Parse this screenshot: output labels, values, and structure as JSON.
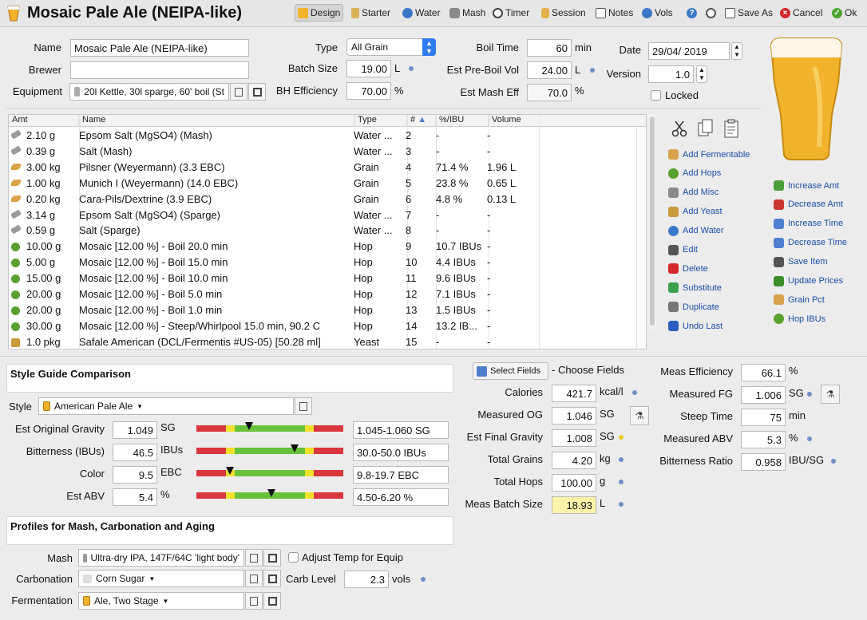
{
  "header": {
    "title": "Mosaic Pale Ale (NEIPA-like)",
    "tabs": [
      {
        "label": "Design",
        "icon": "beer-glass-icon"
      },
      {
        "label": "Starter",
        "icon": "test-tube-icon"
      },
      {
        "label": "Water",
        "icon": "water-drop-icon"
      },
      {
        "label": "Mash",
        "icon": "mash-tun-icon"
      },
      {
        "label": "Timer",
        "icon": "clock-icon"
      },
      {
        "label": "Session",
        "icon": "jar-icon"
      },
      {
        "label": "Notes",
        "icon": "notes-icon"
      },
      {
        "label": "Vols",
        "icon": "drop-icon"
      }
    ],
    "save_as": "Save As",
    "cancel": "Cancel",
    "ok": "Ok"
  },
  "form": {
    "name_label": "Name",
    "name_value": "Mosaic Pale Ale (NEIPA-like)",
    "brewer_label": "Brewer",
    "brewer_value": "",
    "equipment_label": "Equipment",
    "equipment_value": "20l Kettle, 30l sparge, 60' boil (St",
    "type_label": "Type",
    "type_value": "All Grain",
    "batch_label": "Batch Size",
    "batch_value": "19.00",
    "batch_unit": "L",
    "bh_label": "BH Efficiency",
    "bh_value": "70.00",
    "bh_unit": "%",
    "boil_label": "Boil Time",
    "boil_value": "60",
    "boil_unit": "min",
    "preboil_label": "Est Pre-Boil Vol",
    "preboil_value": "24.00",
    "preboil_unit": "L",
    "mash_eff_label": "Est Mash Eff",
    "mash_eff_value": "70.0",
    "mash_eff_unit": "%",
    "date_label": "Date",
    "date_value": "29/04/ 2019",
    "version_label": "Version",
    "version_value": "1.0",
    "locked_label": "Locked"
  },
  "table": {
    "headers": [
      "Amt",
      "Name",
      "Type",
      "#",
      "%/IBU",
      "Volume"
    ],
    "rows": [
      {
        "amt": "2.10 g",
        "name": "Epsom Salt (MgSO4) (Mash)",
        "type": "Water ...",
        "num": "2",
        "pct": "-",
        "vol": "-",
        "icon": "salt-icon"
      },
      {
        "amt": "0.39 g",
        "name": "Salt (Mash)",
        "type": "Water ...",
        "num": "3",
        "pct": "-",
        "vol": "-",
        "icon": "salt-icon"
      },
      {
        "amt": "3.00 kg",
        "name": "Pilsner (Weyermann) (3.3 EBC)",
        "type": "Grain",
        "num": "4",
        "pct": "71.4 %",
        "vol": "1.96 L",
        "icon": "grain-icon"
      },
      {
        "amt": "1.00 kg",
        "name": "Munich I (Weyermann) (14.0 EBC)",
        "type": "Grain",
        "num": "5",
        "pct": "23.8 %",
        "vol": "0.65 L",
        "icon": "grain-icon"
      },
      {
        "amt": "0.20 kg",
        "name": "Cara-Pils/Dextrine (3.9 EBC)",
        "type": "Grain",
        "num": "6",
        "pct": "4.8 %",
        "vol": "0.13 L",
        "icon": "grain-icon"
      },
      {
        "amt": "3.14 g",
        "name": "Epsom Salt (MgSO4) (Sparge)",
        "type": "Water ...",
        "num": "7",
        "pct": "-",
        "vol": "-",
        "icon": "salt-icon"
      },
      {
        "amt": "0.59 g",
        "name": "Salt (Sparge)",
        "type": "Water ...",
        "num": "8",
        "pct": "-",
        "vol": "-",
        "icon": "salt-icon"
      },
      {
        "amt": "10.00 g",
        "name": "Mosaic [12.00 %] - Boil 20.0 min",
        "type": "Hop",
        "num": "9",
        "pct": "10.7 IBUs",
        "vol": "-",
        "icon": "hop-icon"
      },
      {
        "amt": "5.00 g",
        "name": "Mosaic [12.00 %] - Boil 15.0 min",
        "type": "Hop",
        "num": "10",
        "pct": "4.4 IBUs",
        "vol": "-",
        "icon": "hop-icon"
      },
      {
        "amt": "15.00 g",
        "name": "Mosaic [12.00 %] - Boil 10.0 min",
        "type": "Hop",
        "num": "11",
        "pct": "9.6 IBUs",
        "vol": "-",
        "icon": "hop-icon"
      },
      {
        "amt": "20.00 g",
        "name": "Mosaic [12.00 %] - Boil 5.0 min",
        "type": "Hop",
        "num": "12",
        "pct": "7.1 IBUs",
        "vol": "-",
        "icon": "hop-icon"
      },
      {
        "amt": "20.00 g",
        "name": "Mosaic [12.00 %] - Boil 1.0 min",
        "type": "Hop",
        "num": "13",
        "pct": "1.5 IBUs",
        "vol": "-",
        "icon": "hop-icon"
      },
      {
        "amt": "30.00 g",
        "name": "Mosaic [12.00 %] - Steep/Whirlpool  15.0 min, 90.2 C",
        "type": "Hop",
        "num": "14",
        "pct": "13.2 IB...",
        "vol": "-",
        "icon": "hop-icon"
      },
      {
        "amt": "1.0 pkg",
        "name": "Safale American  (DCL/Fermentis #US-05) [50.28 ml]",
        "type": "Yeast",
        "num": "15",
        "pct": "-",
        "vol": "-",
        "icon": "yeast-icon"
      }
    ]
  },
  "actions": [
    {
      "label": "Add Fermentable",
      "icon": "grain-icon",
      "color": "#d8a24a"
    },
    {
      "label": "Add Hops",
      "icon": "hop-icon",
      "color": "#5aa02c"
    },
    {
      "label": "Add Misc",
      "icon": "salt-icon",
      "color": "#8a8a8a"
    },
    {
      "label": "Add Yeast",
      "icon": "yeast-icon",
      "color": "#c99a3a"
    },
    {
      "label": "Add Water",
      "icon": "water-drop-icon",
      "color": "#3b78c9"
    },
    {
      "label": "Edit",
      "icon": "edit-icon",
      "color": "#555555"
    },
    {
      "label": "Delete",
      "icon": "delete-icon",
      "color": "#d4262c"
    },
    {
      "label": "Substitute",
      "icon": "substitute-icon",
      "color": "#3aa04a"
    },
    {
      "label": "Duplicate",
      "icon": "duplicate-icon",
      "color": "#777777"
    },
    {
      "label": "Undo Last",
      "icon": "undo-icon",
      "color": "#2b5fbf"
    }
  ],
  "actions2": [
    {
      "label": "Increase Amt",
      "icon": "arrow-up-icon",
      "color": "#4a9e3a"
    },
    {
      "label": "Decrease Amt",
      "icon": "arrow-down-icon",
      "color": "#c9362e"
    },
    {
      "label": "Increase Time",
      "icon": "triangle-up-icon",
      "color": "#4f7fcf"
    },
    {
      "label": "Decrease Time",
      "icon": "triangle-down-icon",
      "color": "#4f7fcf"
    },
    {
      "label": "Save Item",
      "icon": "save-icon",
      "color": "#555555"
    },
    {
      "label": "Update Prices",
      "icon": "dollar-icon",
      "color": "#3a8e2a"
    },
    {
      "label": "Grain Pct",
      "icon": "grain-icon",
      "color": "#d8a24a"
    },
    {
      "label": "Hop IBUs",
      "icon": "hop-icon",
      "color": "#5aa02c"
    }
  ],
  "style": {
    "section_title": "Style Guide Comparison",
    "style_label": "Style",
    "style_value": "American Pale Ale",
    "rows": [
      {
        "label": "Est Original Gravity",
        "value": "1.049",
        "unit": "SG",
        "range": "1.045-1.060 SG",
        "marker": 0.36
      },
      {
        "label": "Bitterness (IBUs)",
        "value": "46.5",
        "unit": "IBUs",
        "range": "30.0-50.0 IBUs",
        "marker": 0.67
      },
      {
        "label": "Color",
        "value": "9.5",
        "unit": "EBC",
        "range": "9.8-19.7 EBC",
        "marker": 0.23
      },
      {
        "label": "Est ABV",
        "value": "5.4",
        "unit": "%",
        "range": "4.50-6.20 %",
        "marker": 0.51
      }
    ]
  },
  "profiles": {
    "section_title": "Profiles for Mash, Carbonation and Aging",
    "mash_label": "Mash",
    "mash_value": "Ultra-dry IPA, 147F/64C 'light body'",
    "adjust_label": "Adjust Temp for Equip",
    "carb_label": "Carbonation",
    "carb_value": "Corn Sugar",
    "carb_level_label": "Carb Level",
    "carb_level_value": "2.3",
    "carb_level_unit": "vols",
    "ferm_label": "Fermentation",
    "ferm_value": "Ale, Two Stage"
  },
  "stats": {
    "select_fields": "Select Fields",
    "choose_fields": "- Choose Fields",
    "left": [
      {
        "label": "Calories",
        "value": "421.7",
        "unit": "kcal/l"
      },
      {
        "label": "Measured OG",
        "value": "1.046",
        "unit": "SG"
      },
      {
        "label": "Est Final Gravity",
        "value": "1.008",
        "unit": "SG"
      },
      {
        "label": "Total Grains",
        "value": "4.20",
        "unit": "kg"
      },
      {
        "label": "Total Hops",
        "value": "100.00",
        "unit": "g"
      },
      {
        "label": "Meas Batch Size",
        "value": "18.93",
        "unit": "L"
      }
    ],
    "right": [
      {
        "label": "Meas Efficiency",
        "value": "66.1",
        "unit": "%"
      },
      {
        "label": "Measured FG",
        "value": "1.006",
        "unit": "SG"
      },
      {
        "label": "Steep Time",
        "value": "75",
        "unit": "min"
      },
      {
        "label": "Measured ABV",
        "value": "5.3",
        "unit": "%"
      },
      {
        "label": "Bitterness Ratio",
        "value": "0.958",
        "unit": "IBU/SG"
      }
    ]
  }
}
